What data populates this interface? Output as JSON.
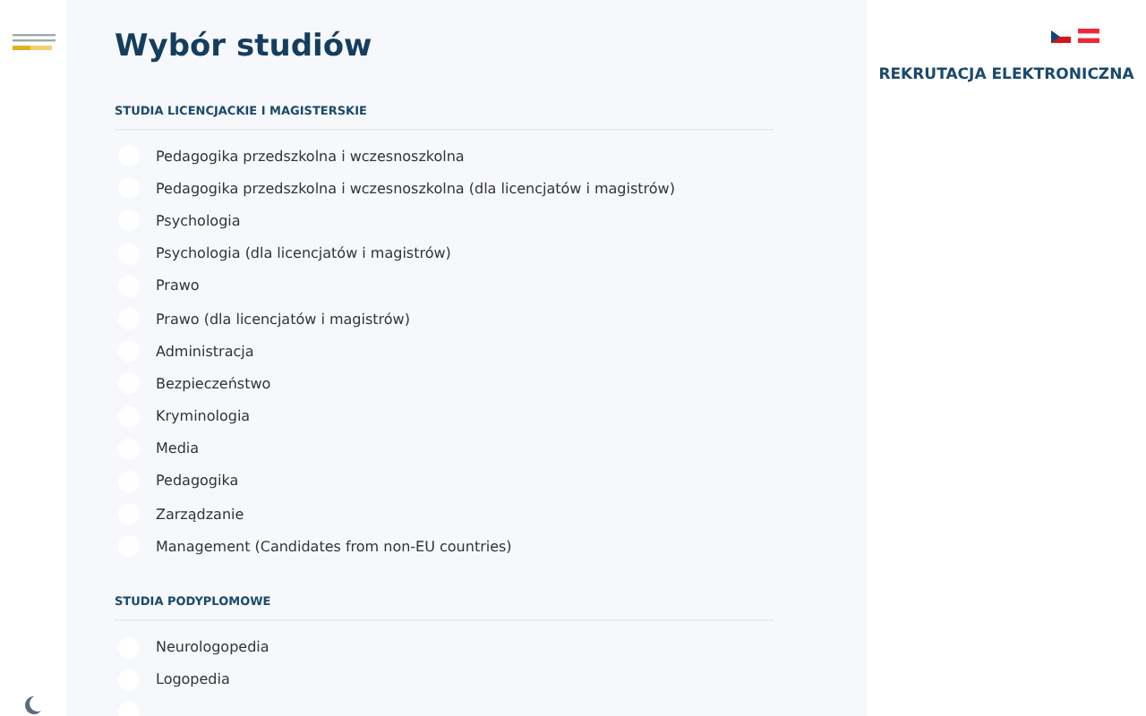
{
  "page": {
    "title": "Wybór studiów"
  },
  "sections": [
    {
      "heading": "STUDIA LICENCJACKIE I MAGISTERSKIE",
      "options": [
        {
          "label": "Pedagogika przedszkolna i wczesnoszkolna",
          "selected": false
        },
        {
          "label": "Pedagogika przedszkolna i wczesnoszkolna (dla licencjatów i magistrów)",
          "selected": false
        },
        {
          "label": "Psychologia",
          "selected": false
        },
        {
          "label": "Psychologia (dla licencjatów i magistrów)",
          "selected": false
        },
        {
          "label": "Prawo",
          "selected": false
        },
        {
          "label": "Prawo (dla licencjatów i magistrów)",
          "selected": false
        },
        {
          "label": "Administracja",
          "selected": false
        },
        {
          "label": "Bezpieczeństwo",
          "selected": false
        },
        {
          "label": "Kryminologia",
          "selected": false
        },
        {
          "label": "Media",
          "selected": false
        },
        {
          "label": "Pedagogika",
          "selected": false
        },
        {
          "label": "Zarządzanie",
          "selected": false
        },
        {
          "label": "Management (Candidates from non-EU countries)",
          "selected": false
        }
      ]
    },
    {
      "heading": "STUDIA PODYPLOMOWE",
      "options": [
        {
          "label": "Neurologopedia",
          "selected": false
        },
        {
          "label": "Logopedia",
          "selected": false
        }
      ]
    }
  ],
  "cut_option": {
    "selected": false
  },
  "sidebar": {
    "title": "REKRUTACJA ELEKTRONICZNA"
  }
}
